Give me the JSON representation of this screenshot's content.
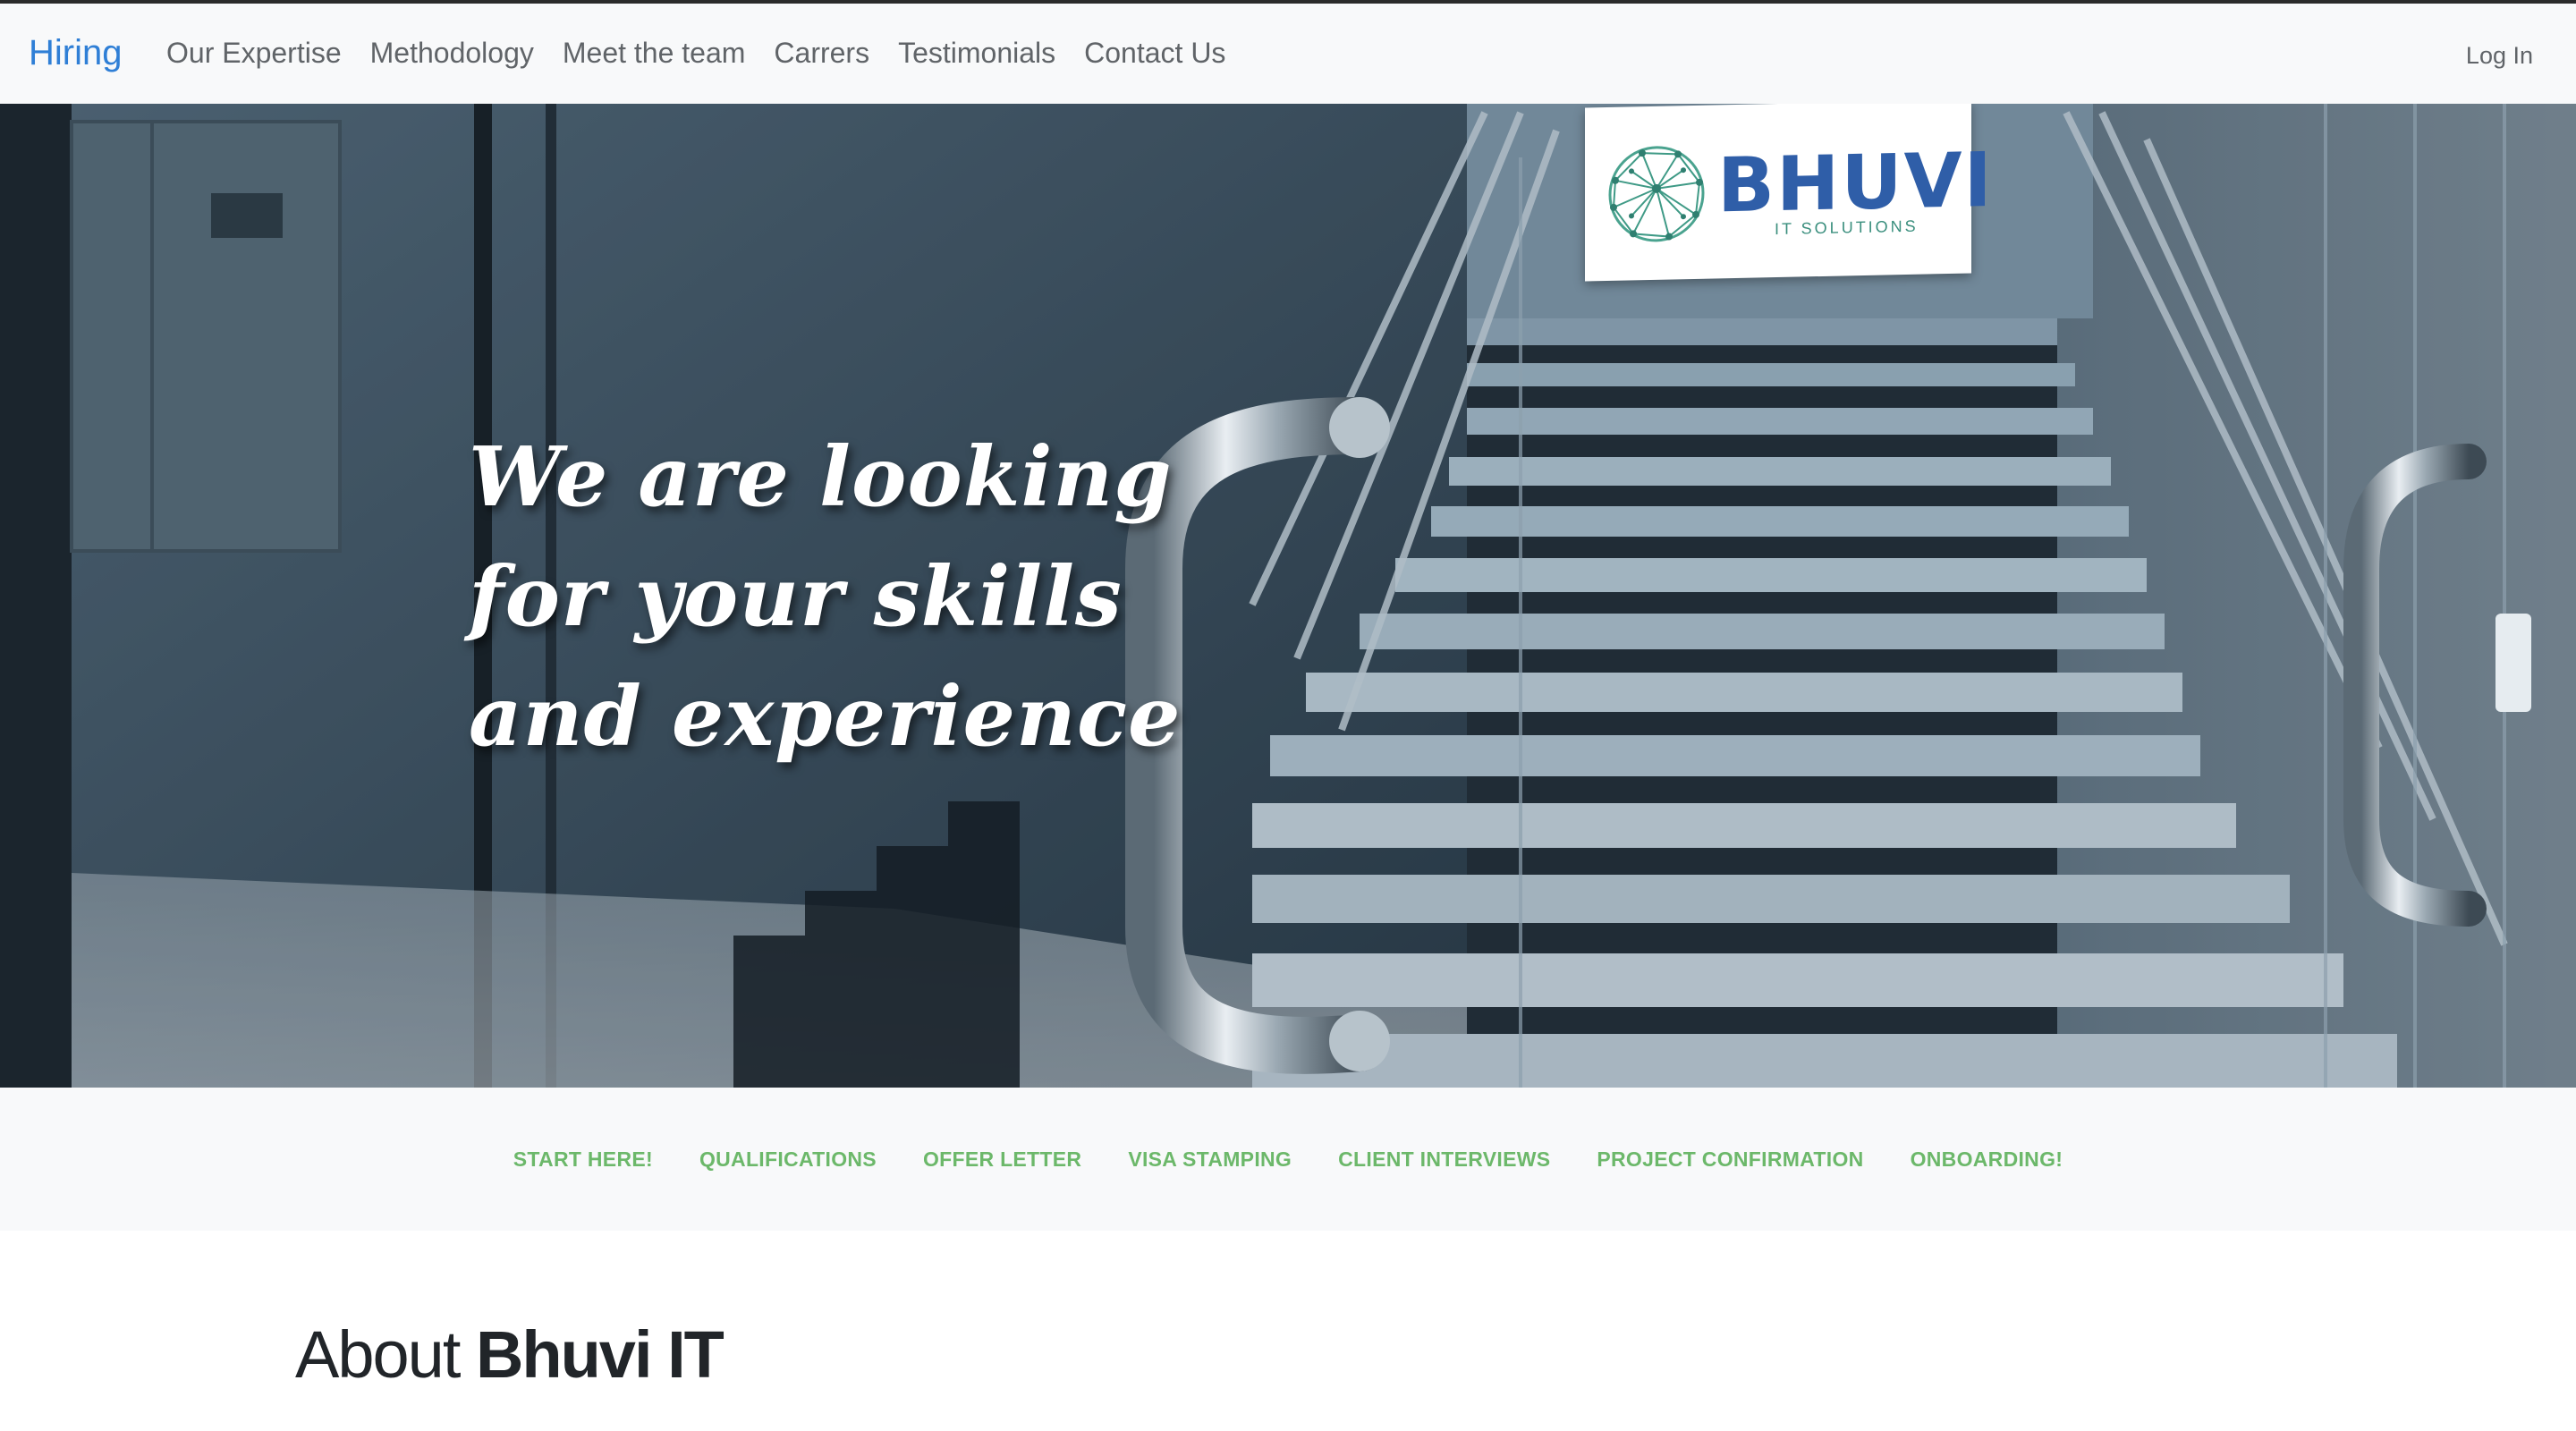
{
  "navbar": {
    "brand": "Hiring",
    "links": [
      "Our Expertise",
      "Methodology",
      "Meet the team",
      "Carrers",
      "Testimonials",
      "Contact Us"
    ],
    "login": "Log In"
  },
  "hero": {
    "lines": [
      "We are looking",
      "for your skills",
      "and experience"
    ],
    "logo": {
      "name": "BHUVI",
      "subtitle": "IT SOLUTIONS",
      "icon": "globe-network-icon"
    }
  },
  "steps": [
    "START HERE!",
    "QUALIFICATIONS",
    "OFFER LETTER",
    "VISA STAMPING",
    "CLIENT INTERVIEWS",
    "PROJECT CONFIRMATION",
    "ONBOARDING!"
  ],
  "about": {
    "prefix": "About",
    "name": "Bhuvi IT"
  },
  "colors": {
    "brand": "#2f7fd6",
    "step_link": "#6cb86a",
    "logo_blue": "#2f5ea8",
    "logo_teal": "#3b8f7e"
  }
}
